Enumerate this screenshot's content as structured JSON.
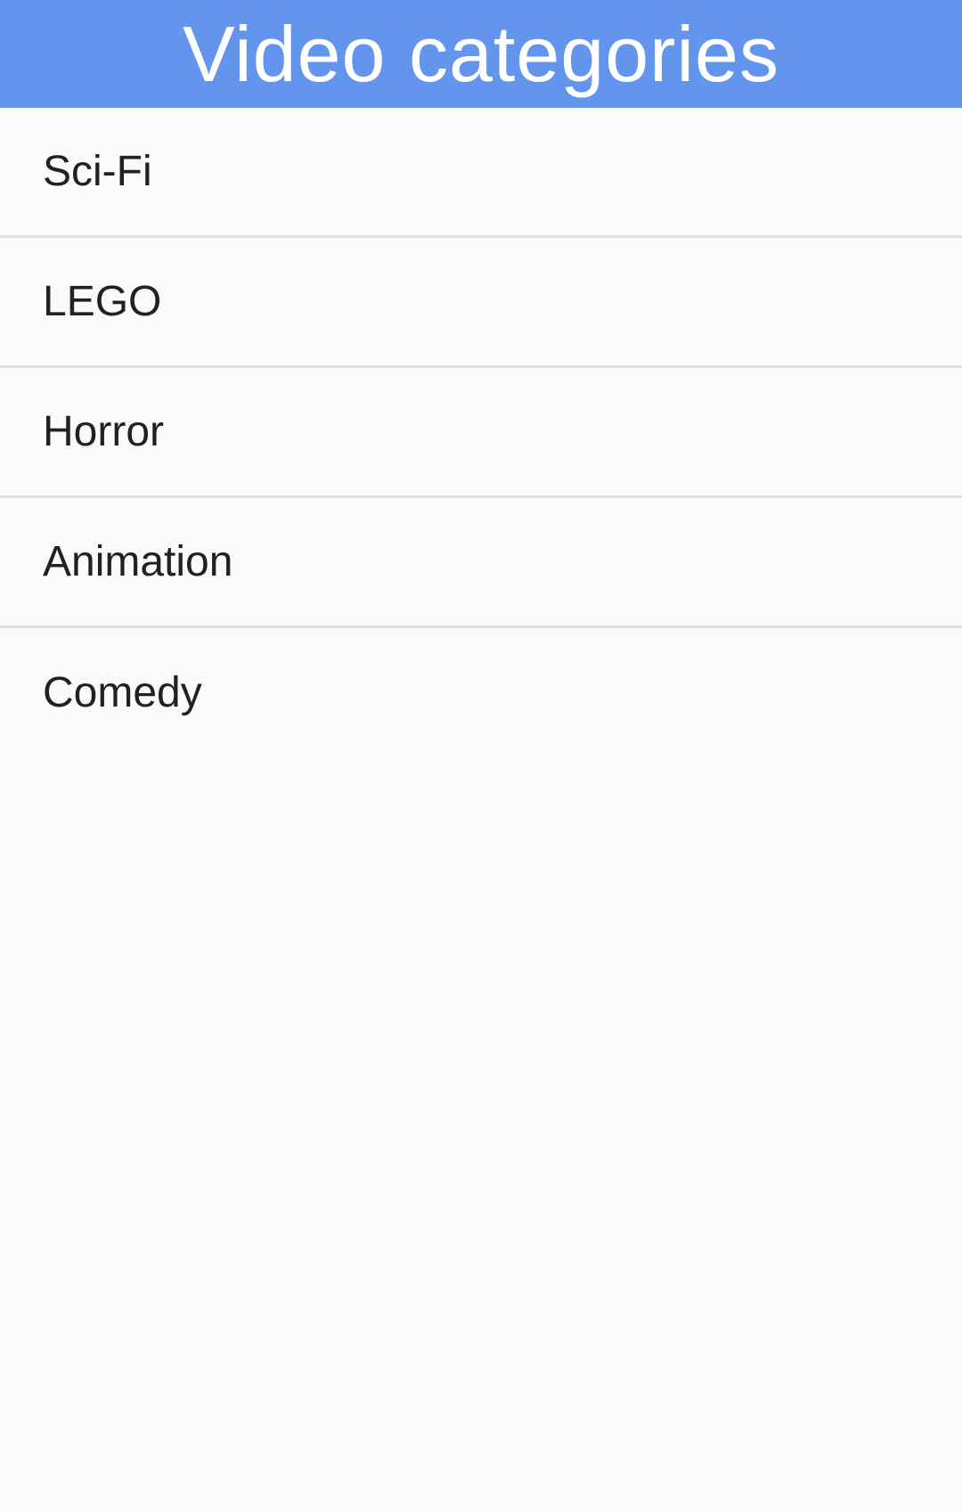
{
  "header": {
    "title": "Video categories"
  },
  "categories": [
    {
      "label": "Sci-Fi"
    },
    {
      "label": "LEGO"
    },
    {
      "label": "Horror"
    },
    {
      "label": "Animation"
    },
    {
      "label": "Comedy"
    }
  ],
  "colors": {
    "app_bar": "#6495ed",
    "background": "#fafafa",
    "divider": "#dedede",
    "text": "#212121"
  }
}
